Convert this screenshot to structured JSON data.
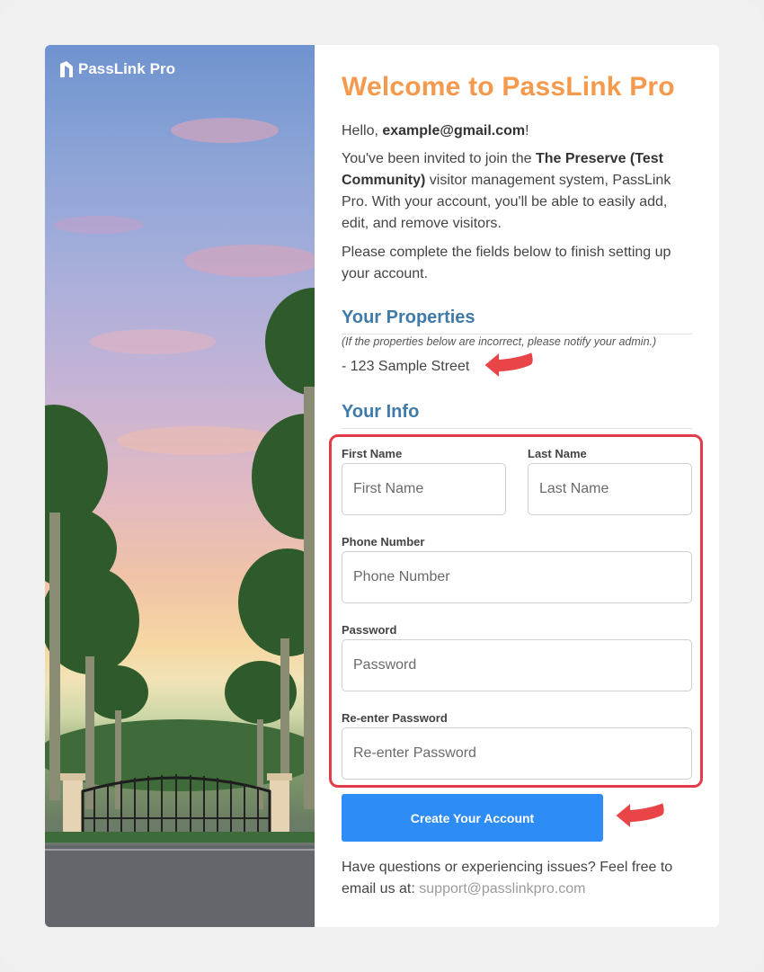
{
  "brand": {
    "name": "PassLink",
    "suffix": "Pro"
  },
  "page": {
    "title": "Welcome to PassLink Pro",
    "greeting_prefix": "Hello, ",
    "greeting_email": "example@gmail.com",
    "greeting_suffix": "!",
    "invite_part1": "You've been invited to join the ",
    "invite_community": "The Preserve (Test Community)",
    "invite_part2": " visitor management system, PassLink Pro. With your account, you'll be able to easily add, edit, and remove visitors.",
    "instructions": "Please complete the fields below to finish setting up your account."
  },
  "properties": {
    "heading": "Your Properties",
    "note": "(If the properties below are incorrect, please notify your admin.)",
    "items": [
      "- 123 Sample Street"
    ]
  },
  "info": {
    "heading": "Your Info",
    "first_name": {
      "label": "First Name",
      "placeholder": "First Name",
      "value": ""
    },
    "last_name": {
      "label": "Last Name",
      "placeholder": "Last Name",
      "value": ""
    },
    "phone": {
      "label": "Phone Number",
      "placeholder": "Phone Number",
      "value": ""
    },
    "password": {
      "label": "Password",
      "placeholder": "Password",
      "value": ""
    },
    "confirm_password": {
      "label": "Re-enter Password",
      "placeholder": "Re-enter Password",
      "value": ""
    }
  },
  "actions": {
    "create_label": "Create Your Account"
  },
  "support": {
    "text": "Have questions or experiencing issues? Feel free to email us at: ",
    "email": "support@passlinkpro.com"
  },
  "colors": {
    "title": "#f59a4d",
    "heading": "#3f7aa9",
    "button": "#2e8cf6",
    "annotation": "#e23b4a"
  }
}
